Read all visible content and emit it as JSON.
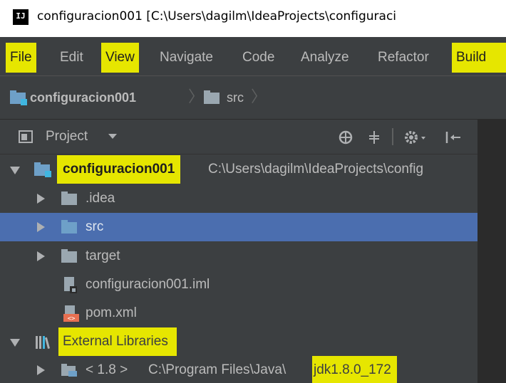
{
  "window": {
    "title": "configuracion001 [C:\\Users\\dagilm\\IdeaProjects\\configuraci",
    "app_icon": "IJ"
  },
  "menu": [
    {
      "label": "File",
      "highlighted": true
    },
    {
      "label": "Edit",
      "highlighted": false
    },
    {
      "label": "View",
      "highlighted": true
    },
    {
      "label": "Navigate",
      "highlighted": false
    },
    {
      "label": "Code",
      "highlighted": false
    },
    {
      "label": "Analyze",
      "highlighted": false
    },
    {
      "label": "Refactor",
      "highlighted": false
    },
    {
      "label": "Build",
      "highlighted": true
    }
  ],
  "breadcrumb": {
    "project": "configuracion001",
    "folder": "src"
  },
  "project_panel": {
    "title": "Project",
    "icons": [
      "target-icon",
      "collapse-all-icon",
      "gear-icon",
      "hide-icon"
    ]
  },
  "tree": {
    "root_name": "configuracion001",
    "root_path": "C:\\Users\\dagilm\\IdeaProjects\\config",
    "idea": ".idea",
    "src": "src",
    "target": "target",
    "iml": "configuracion001.iml",
    "pom": "pom.xml",
    "external": "External Libraries",
    "jdk_version": "< 1.8 >",
    "jdk_path": "C:\\Program Files\\Java\\",
    "jdk_name": "jdk1.8.0_172"
  },
  "colors": {
    "ide_background": "#3c3f41",
    "selection": "#4b6eaf",
    "highlight": "#e6e600",
    "text": "#bbbbbb"
  }
}
